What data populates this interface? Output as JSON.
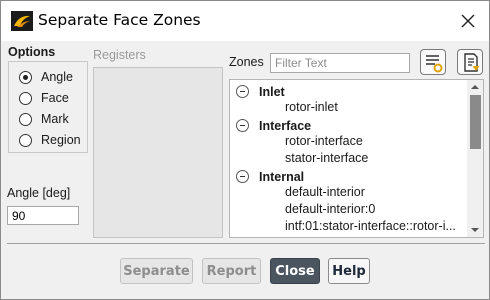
{
  "window": {
    "title": "Separate Face Zones",
    "close_icon": "close-icon"
  },
  "options": {
    "label": "Options",
    "radios": [
      {
        "label": "Angle",
        "selected": true
      },
      {
        "label": "Face",
        "selected": false
      },
      {
        "label": "Mark",
        "selected": false
      },
      {
        "label": "Region",
        "selected": false
      }
    ]
  },
  "angle": {
    "label": "Angle [deg]",
    "value": "90"
  },
  "registers": {
    "label": "Registers"
  },
  "zones": {
    "label": "Zones",
    "filter_placeholder": "Filter Text",
    "groups": [
      {
        "name": "Inlet",
        "items": [
          "rotor-inlet"
        ]
      },
      {
        "name": "Interface",
        "items": [
          "rotor-interface",
          "stator-interface"
        ]
      },
      {
        "name": "Internal",
        "items": [
          "default-interior",
          "default-interior:0",
          "intf:01:stator-interface::rotor-i..."
        ]
      }
    ]
  },
  "buttons": {
    "separate": "Separate",
    "report": "Report",
    "close": "Close",
    "help": "Help"
  },
  "colors": {
    "primary_button": "#4a5560",
    "disabled_text": "#8d8d8d"
  }
}
